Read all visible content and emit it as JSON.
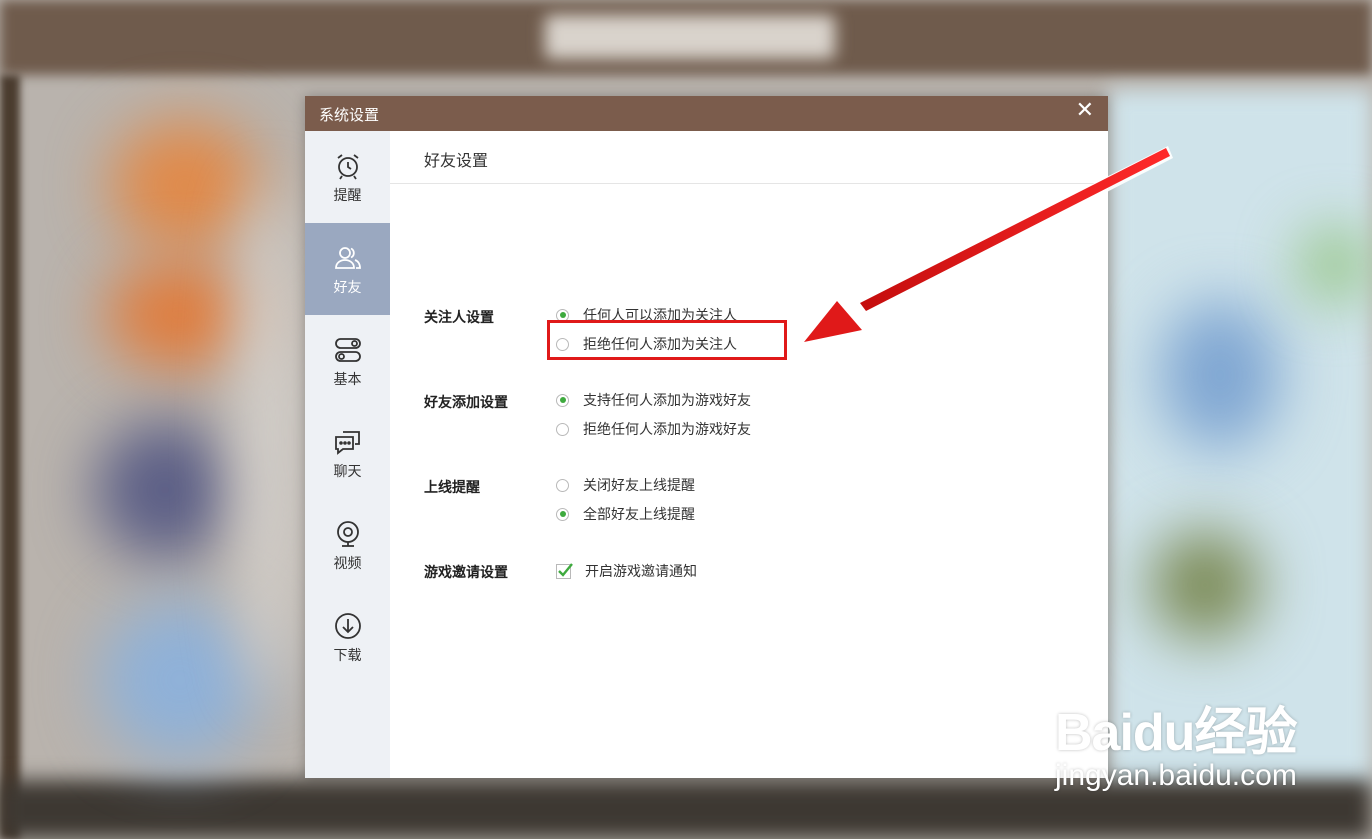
{
  "dialog": {
    "title": "系统设置",
    "close_glyph": "✕"
  },
  "sidebar": {
    "items": [
      {
        "label": "提醒",
        "icon": "alarm-clock-icon"
      },
      {
        "label": "好友",
        "icon": "friends-icon",
        "active": true
      },
      {
        "label": "基本",
        "icon": "toggle-icon"
      },
      {
        "label": "聊天",
        "icon": "chat-icon"
      },
      {
        "label": "视频",
        "icon": "webcam-icon"
      },
      {
        "label": "下载",
        "icon": "download-icon"
      }
    ]
  },
  "content": {
    "header": "好友设置",
    "groups": [
      {
        "label": "关注人设置",
        "options": [
          {
            "text": "任何人可以添加为关注人",
            "selected": true
          },
          {
            "text": "拒绝任何人添加为关注人",
            "selected": false
          }
        ]
      },
      {
        "label": "好友添加设置",
        "options": [
          {
            "text": "支持任何人添加为游戏好友",
            "selected": true
          },
          {
            "text": "拒绝任何人添加为游戏好友",
            "selected": false
          }
        ]
      },
      {
        "label": "上线提醒",
        "options": [
          {
            "text": "关闭好友上线提醒",
            "selected": false
          },
          {
            "text": "全部好友上线提醒",
            "selected": true
          }
        ]
      },
      {
        "label": "游戏邀请设置",
        "options": [
          {
            "text": "开启游戏邀请通知",
            "checked": true
          }
        ]
      }
    ]
  },
  "annotation": {
    "highlight_color": "#e01919"
  },
  "watermark": {
    "brand": "Baidu经验",
    "url": "jingyan.baidu.com"
  },
  "colors": {
    "titlebar": "#7b5c4c",
    "sidebar_active": "#9aa8c0",
    "radio_selected": "#3eaa3e"
  }
}
